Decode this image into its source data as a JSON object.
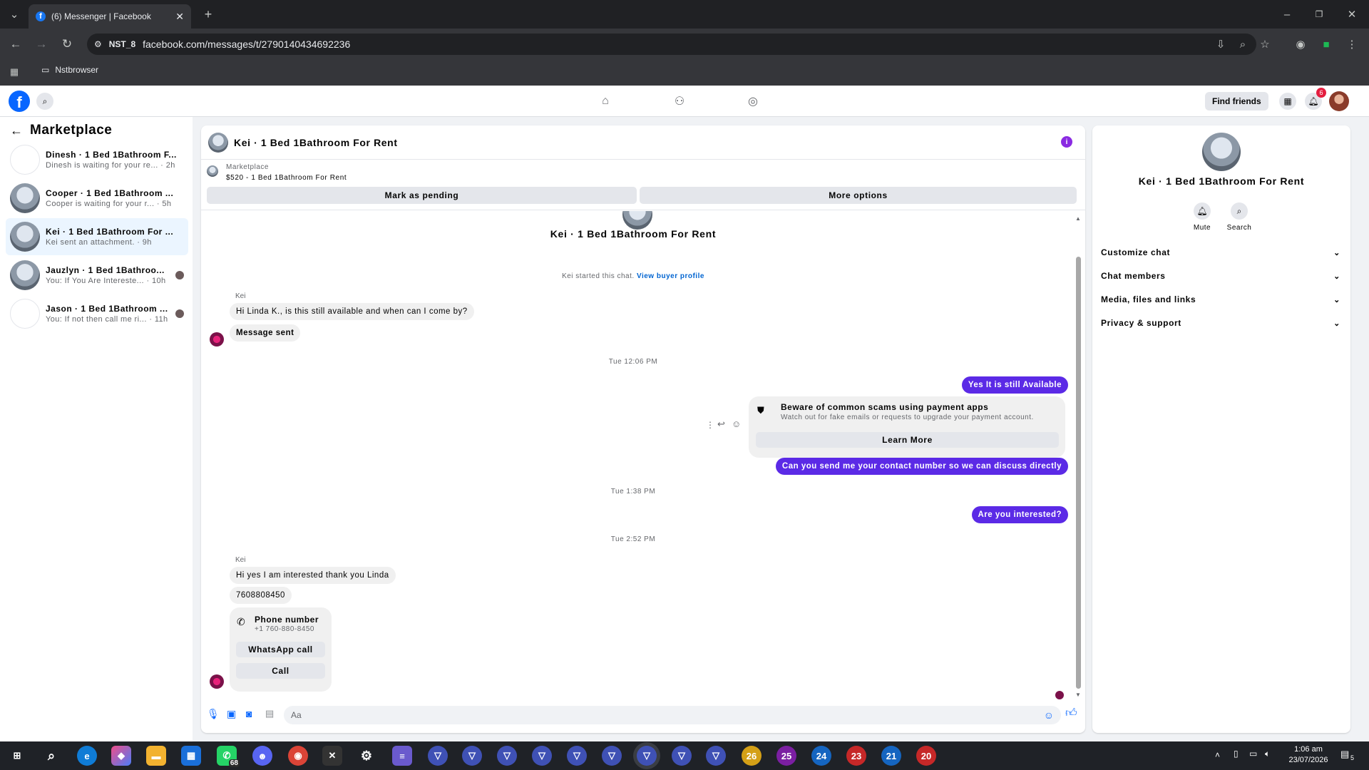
{
  "browser": {
    "tab_title": "(6) Messenger | Facebook",
    "profile_chip": "NST_8",
    "url": "facebook.com/messages/t/2790140434692236",
    "bookmark_folder": "Nstbrowser"
  },
  "fb_nav": {
    "logo": "f",
    "find_friends": "Find friends",
    "notification_count": "6"
  },
  "left": {
    "title": "Marketplace",
    "conversations": [
      {
        "name": "Dinesh · 1 Bed 1Bathroom F...",
        "preview": "Dinesh is waiting for your re...",
        "time": "· 2h"
      },
      {
        "name": "Cooper · 1 Bed 1Bathroom ...",
        "preview": "Cooper is waiting for your r...",
        "time": "· 5h"
      },
      {
        "name": "Kei · 1 Bed 1Bathroom For ...",
        "preview": "Kei sent an attachment.",
        "time": "· 9h"
      },
      {
        "name": "Jauzlyn · 1 Bed 1Bathroo...",
        "preview": "You: If You Are Intereste...",
        "time": "· 10h"
      },
      {
        "name": "Jason · 1 Bed 1Bathroom ...",
        "preview": "You: If not then call me ri...",
        "time": "· 11h"
      }
    ]
  },
  "chat": {
    "header_title": "Kei · 1 Bed 1Bathroom For Rent",
    "listing_source": "Marketplace",
    "listing_line": "$520 - 1 Bed 1Bathroom For Rent",
    "mark_pending": "Mark as pending",
    "more_options": "More options",
    "profile_name": "Kei · 1 Bed 1Bathroom For Rent",
    "started_text": "Kei started this chat.",
    "view_buyer_profile": "View buyer profile",
    "sender_label_1": "Kei",
    "msg_in_1": "Hi Linda K., is this still available and when can I come by?",
    "msg_in_2": "Message sent",
    "time_1": "Tue 12:06 PM",
    "msg_out_1": "Yes It is still Available",
    "warning_title": "Beware of common scams using payment apps",
    "warning_body": "Watch out for fake emails or requests to upgrade your payment account.",
    "learn_more": "Learn More",
    "msg_out_2": "Can you send me your contact number so we can discuss directly",
    "time_2": "Tue 1:38 PM",
    "msg_out_3": "Are you interested?",
    "time_3": "Tue 2:52 PM",
    "sender_label_2": "Kei",
    "msg_in_3": "Hi yes I am interested thank you Linda",
    "msg_in_4": "7608808450",
    "phone_card_title": "Phone number",
    "phone_card_number": "+1 760-880-8450",
    "whatsapp_call": "WhatsApp call",
    "call": "Call",
    "composer_placeholder": "Aa"
  },
  "right": {
    "name": "Kei · 1 Bed 1Bathroom For Rent",
    "mute": "Mute",
    "search": "Search",
    "sections": [
      "Customize chat",
      "Chat members",
      "Media, files and links",
      "Privacy & support"
    ]
  },
  "taskbar": {
    "whatsapp_badge": "68",
    "app_numbers": [
      "26",
      "25",
      "24",
      "23",
      "21",
      "20"
    ],
    "time": "1:06 am",
    "date": "23/07/2026",
    "notification_count": "5"
  },
  "colors": {
    "accent_purple": "#5b2ae6",
    "fb_blue": "#0866ff",
    "link_blue": "#0064d1"
  }
}
